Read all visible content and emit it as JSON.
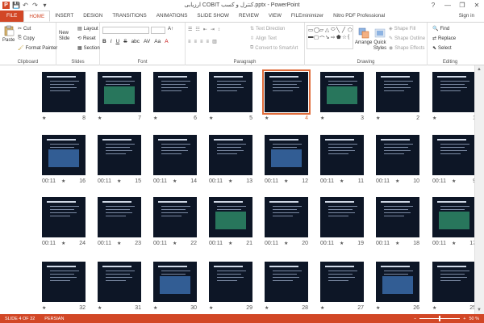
{
  "window": {
    "title": "ارزیابی COBIT کنترل و کسب.pptx - PowerPoint",
    "help": "?",
    "minimize": "—",
    "restore": "❐",
    "close": "✕"
  },
  "qat": {
    "logo": "P",
    "save": "💾",
    "undo": "↶",
    "redo": "↷",
    "customize": "▾"
  },
  "tabs": [
    {
      "label": "FILE"
    },
    {
      "label": "HOME"
    },
    {
      "label": "INSERT"
    },
    {
      "label": "DESIGN"
    },
    {
      "label": "TRANSITIONS"
    },
    {
      "label": "ANIMATIONS"
    },
    {
      "label": "SLIDE SHOW"
    },
    {
      "label": "REVIEW"
    },
    {
      "label": "VIEW"
    },
    {
      "label": "FILEminimizer"
    },
    {
      "label": "Nitro PDF Professional"
    }
  ],
  "signin": "Sign in",
  "ribbon": {
    "clipboard": {
      "label": "Clipboard",
      "paste": "Paste",
      "cut": "Cut",
      "copy": "Copy",
      "format_painter": "Format Painter"
    },
    "slides": {
      "label": "Slides",
      "new_slide": "New Slide",
      "layout": "Layout",
      "reset": "Reset",
      "section": "Section"
    },
    "font": {
      "label": "Font",
      "bold": "B",
      "italic": "I",
      "underline": "U",
      "strike": "S",
      "shadow": "abc",
      "spacing": "AV",
      "case": "Aa",
      "color": "A"
    },
    "paragraph": {
      "label": "Paragraph",
      "text_direction": "Text Direction",
      "align_text": "Align Text",
      "smartart": "Convert to SmartArt"
    },
    "drawing": {
      "label": "Drawing",
      "arrange": "Arrange",
      "quick_styles": "Quick Styles",
      "shape_fill": "Shape Fill",
      "shape_outline": "Shape Outline",
      "shape_effects": "Shape Effects",
      "shapes": [
        "▭",
        "◯",
        "▱",
        "△",
        "⬭",
        "╲",
        "╱",
        "⬠",
        "▬",
        "▢",
        "⌒",
        "↘",
        "⇨",
        "⬟",
        "☆",
        "{"
      ]
    },
    "editing": {
      "label": "Editing",
      "find": "Find",
      "replace": "Replace",
      "select": "Select"
    }
  },
  "slides": [
    {
      "num": "1",
      "time": "",
      "star": "★"
    },
    {
      "num": "2",
      "time": "",
      "star": "★"
    },
    {
      "num": "3",
      "time": "",
      "star": "★"
    },
    {
      "num": "4",
      "time": "",
      "star": "★"
    },
    {
      "num": "5",
      "time": "",
      "star": "★"
    },
    {
      "num": "6",
      "time": "",
      "star": "★"
    },
    {
      "num": "7",
      "time": "",
      "star": "★"
    },
    {
      "num": "8",
      "time": "",
      "star": "★"
    },
    {
      "num": "9",
      "time": "00:11",
      "star": "★"
    },
    {
      "num": "10",
      "time": "00:11",
      "star": "★"
    },
    {
      "num": "11",
      "time": "00:11",
      "star": "★"
    },
    {
      "num": "12",
      "time": "00:11",
      "star": "★"
    },
    {
      "num": "13",
      "time": "00:11",
      "star": "★"
    },
    {
      "num": "14",
      "time": "00:11",
      "star": "★"
    },
    {
      "num": "15",
      "time": "00:11",
      "star": "★"
    },
    {
      "num": "16",
      "time": "00:11",
      "star": "★"
    },
    {
      "num": "17",
      "time": "00:11",
      "star": "★"
    },
    {
      "num": "18",
      "time": "00:11",
      "star": "★"
    },
    {
      "num": "19",
      "time": "00:11",
      "star": "★"
    },
    {
      "num": "20",
      "time": "00:11",
      "star": "★"
    },
    {
      "num": "21",
      "time": "00:11",
      "star": "★"
    },
    {
      "num": "22",
      "time": "00:11",
      "star": "★"
    },
    {
      "num": "23",
      "time": "00:11",
      "star": "★"
    },
    {
      "num": "24",
      "time": "00:11",
      "star": "★"
    },
    {
      "num": "25",
      "time": "",
      "star": "★"
    },
    {
      "num": "26",
      "time": "",
      "star": "★"
    },
    {
      "num": "27",
      "time": "",
      "star": "★"
    },
    {
      "num": "28",
      "time": "",
      "star": "★"
    },
    {
      "num": "29",
      "time": "",
      "star": "★"
    },
    {
      "num": "30",
      "time": "",
      "star": "★"
    },
    {
      "num": "31",
      "time": "",
      "star": "★"
    },
    {
      "num": "32",
      "time": "",
      "star": "★"
    }
  ],
  "selected_slide": "4",
  "status": {
    "slide_of": "SLIDE 4 OF 32",
    "language": "PERSIAN",
    "zoom_level": "50 %",
    "zoom_fraction": 0.5
  },
  "colors": {
    "accent": "#d24726",
    "slide_bg": "#0d1626",
    "selection": "#e06c3a"
  }
}
